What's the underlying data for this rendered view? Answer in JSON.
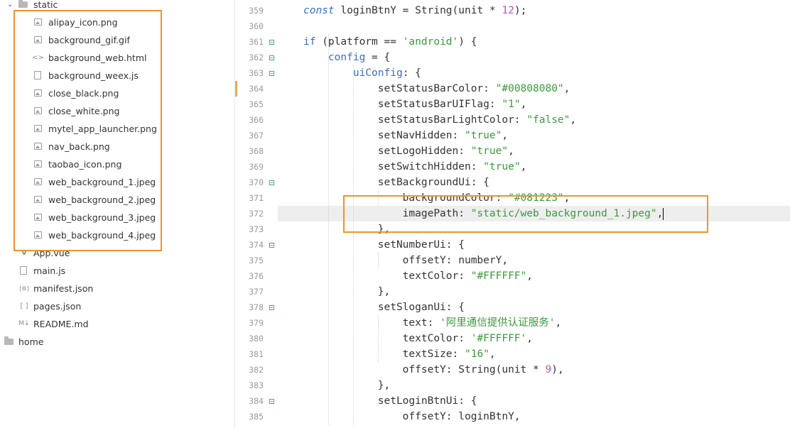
{
  "sidebar": {
    "folder_static": "static",
    "static_files": [
      {
        "name": "alipay_icon.png",
        "icon": "image-file-icon"
      },
      {
        "name": "background_gif.gif",
        "icon": "image-file-icon"
      },
      {
        "name": "background_web.html",
        "icon": "code-file-icon"
      },
      {
        "name": "background_weex.js",
        "icon": "js-file-icon"
      },
      {
        "name": "close_black.png",
        "icon": "image-file-icon"
      },
      {
        "name": "close_white.png",
        "icon": "image-file-icon"
      },
      {
        "name": "mytel_app_launcher.png",
        "icon": "image-file-icon"
      },
      {
        "name": "nav_back.png",
        "icon": "image-file-icon"
      },
      {
        "name": "taobao_icon.png",
        "icon": "image-file-icon"
      },
      {
        "name": "web_background_1.jpeg",
        "icon": "image-file-icon"
      },
      {
        "name": "web_background_2.jpeg",
        "icon": "image-file-icon"
      },
      {
        "name": "web_background_3.jpeg",
        "icon": "image-file-icon"
      },
      {
        "name": "web_background_4.jpeg",
        "icon": "image-file-icon"
      }
    ],
    "root_files": [
      {
        "name": "App.vue",
        "icon": "vue-file-icon"
      },
      {
        "name": "main.js",
        "icon": "js-file-icon"
      },
      {
        "name": "manifest.json",
        "icon": "settings-file-icon"
      },
      {
        "name": "pages.json",
        "icon": "json-file-icon"
      },
      {
        "name": "README.md",
        "icon": "markdown-file-icon"
      }
    ],
    "folder_home": "home"
  },
  "editor": {
    "lines": [
      {
        "n": "359",
        "tokens": [
          [
            "kwi",
            "const"
          ],
          [
            "",
            " loginBtnY = "
          ],
          [
            "fn",
            "String"
          ],
          [
            "",
            "(unit * "
          ],
          [
            "num",
            "12"
          ],
          [
            "",
            ");"
          ]
        ]
      },
      {
        "n": "360",
        "tokens": []
      },
      {
        "n": "361",
        "tokens": [
          [
            "kw",
            "if"
          ],
          [
            "",
            " (platform == "
          ],
          [
            "str",
            "'android'"
          ],
          [
            "",
            ") {"
          ]
        ]
      },
      {
        "n": "362",
        "tokens": [
          [
            "",
            "    "
          ],
          [
            "kw",
            "config"
          ],
          [
            "",
            " = {"
          ]
        ]
      },
      {
        "n": "363",
        "tokens": [
          [
            "",
            "        "
          ],
          [
            "kw",
            "uiConfig"
          ],
          [
            "",
            ": {"
          ]
        ]
      },
      {
        "n": "364",
        "tokens": [
          [
            "",
            "            setStatusBarColor: "
          ],
          [
            "str",
            "\"#00808080\""
          ],
          [
            "",
            ","
          ]
        ]
      },
      {
        "n": "365",
        "tokens": [
          [
            "",
            "            setStatusBarUIFlag: "
          ],
          [
            "str",
            "\"1\""
          ],
          [
            "",
            ","
          ]
        ]
      },
      {
        "n": "366",
        "tokens": [
          [
            "",
            "            setStatusBarLightColor: "
          ],
          [
            "str",
            "\"false\""
          ],
          [
            "",
            ","
          ]
        ]
      },
      {
        "n": "367",
        "tokens": [
          [
            "",
            "            setNavHidden: "
          ],
          [
            "str",
            "\"true\""
          ],
          [
            "",
            ","
          ]
        ]
      },
      {
        "n": "368",
        "tokens": [
          [
            "",
            "            setLogoHidden: "
          ],
          [
            "str",
            "\"true\""
          ],
          [
            "",
            ","
          ]
        ]
      },
      {
        "n": "369",
        "tokens": [
          [
            "",
            "            setSwitchHidden: "
          ],
          [
            "str",
            "\"true\""
          ],
          [
            "",
            ","
          ]
        ]
      },
      {
        "n": "370",
        "tokens": [
          [
            "",
            "            setBackgroundUi: {"
          ]
        ]
      },
      {
        "n": "371",
        "tokens": [
          [
            "",
            "                backgroundColor: "
          ],
          [
            "str",
            "\"#081223\""
          ],
          [
            "",
            ","
          ]
        ]
      },
      {
        "n": "372",
        "tokens": [
          [
            "",
            "                imagePath: "
          ],
          [
            "str",
            "\"static/web_background_1.jpeg\""
          ],
          [
            "",
            ","
          ]
        ]
      },
      {
        "n": "373",
        "tokens": [
          [
            "",
            "            },"
          ]
        ]
      },
      {
        "n": "374",
        "tokens": [
          [
            "",
            "            setNumberUi: {"
          ]
        ]
      },
      {
        "n": "375",
        "tokens": [
          [
            "",
            "                offsetY: numberY,"
          ]
        ]
      },
      {
        "n": "376",
        "tokens": [
          [
            "",
            "                textColor: "
          ],
          [
            "str",
            "\"#FFFFFF\""
          ],
          [
            "",
            ","
          ]
        ]
      },
      {
        "n": "377",
        "tokens": [
          [
            "",
            "            },"
          ]
        ]
      },
      {
        "n": "378",
        "tokens": [
          [
            "",
            "            setSloganUi: {"
          ]
        ]
      },
      {
        "n": "379",
        "tokens": [
          [
            "",
            "                text: "
          ],
          [
            "str",
            "'阿里通信提供认证服务'"
          ],
          [
            "",
            ","
          ]
        ]
      },
      {
        "n": "380",
        "tokens": [
          [
            "",
            "                textColor: "
          ],
          [
            "str",
            "'#FFFFFF'"
          ],
          [
            "",
            ","
          ]
        ]
      },
      {
        "n": "381",
        "tokens": [
          [
            "",
            "                textSize: "
          ],
          [
            "str",
            "\"16\""
          ],
          [
            "",
            ","
          ]
        ]
      },
      {
        "n": "382",
        "tokens": [
          [
            "",
            "                offsetY: "
          ],
          [
            "fn",
            "String"
          ],
          [
            "",
            "(unit * "
          ],
          [
            "num",
            "9"
          ],
          [
            "",
            "),"
          ]
        ]
      },
      {
        "n": "383",
        "tokens": [
          [
            "",
            "            },"
          ]
        ]
      },
      {
        "n": "384",
        "tokens": [
          [
            "",
            "            setLoginBtnUi: {"
          ]
        ]
      },
      {
        "n": "385",
        "tokens": [
          [
            "",
            "                offsetY: loginBtnY,"
          ]
        ]
      }
    ]
  },
  "colors": {
    "highlight": "#f0932b",
    "string": "#3a9a3a",
    "keyword": "#3a6ec8",
    "number": "#c050c0"
  }
}
